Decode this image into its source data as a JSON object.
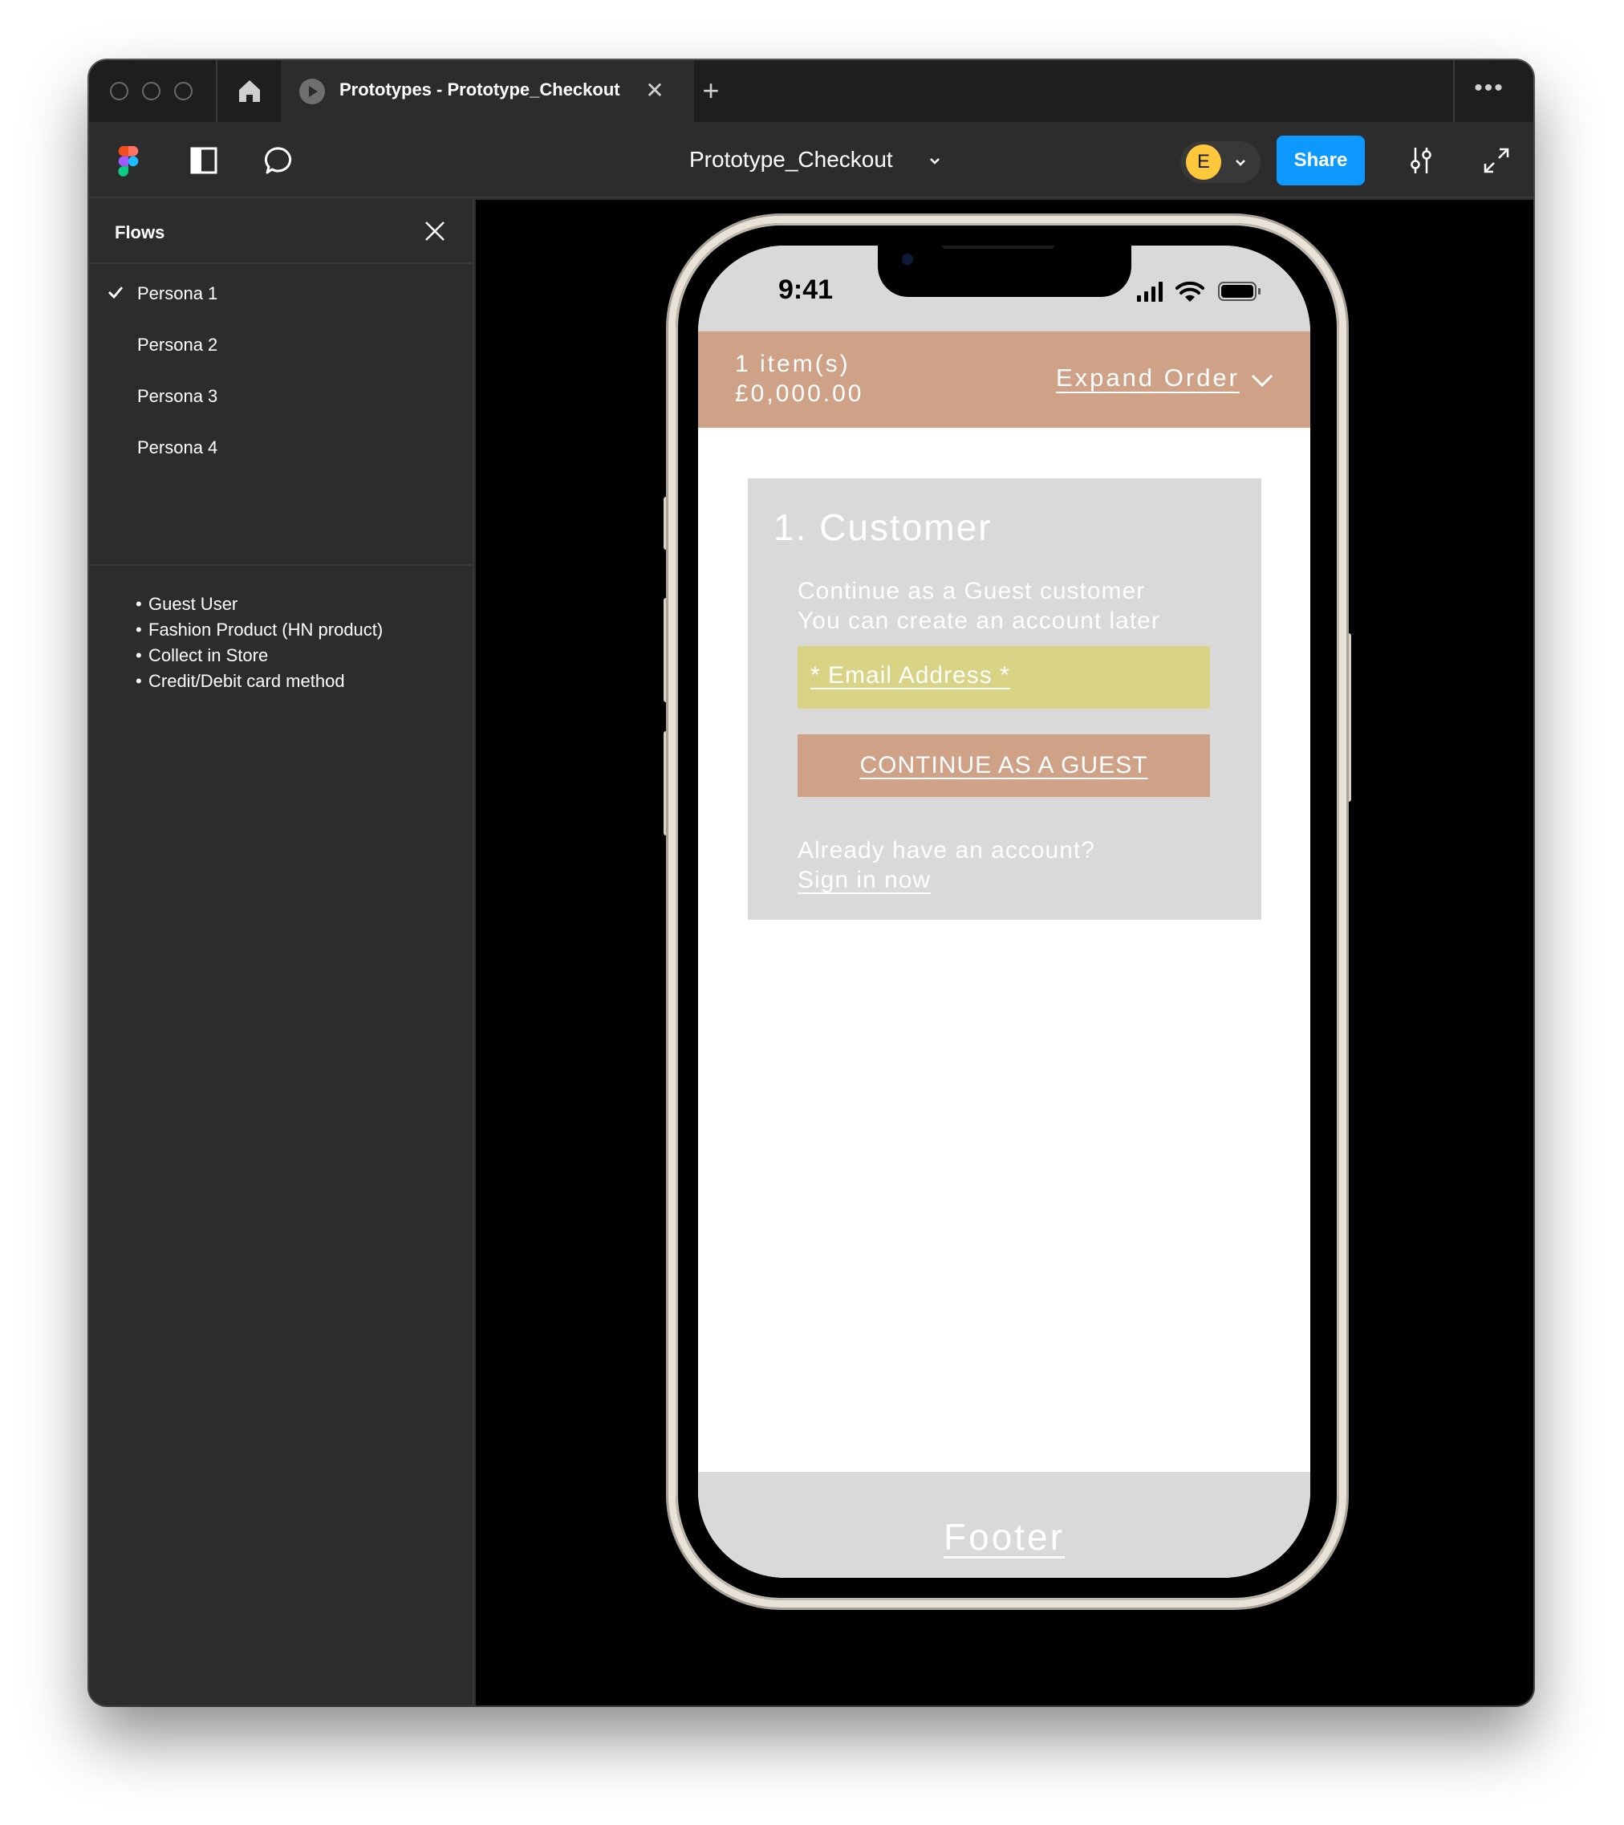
{
  "tabbar": {
    "tab_title": "Prototypes - Prototype_Checkout",
    "close_glyph": "✕",
    "add_glyph": "+",
    "more_glyph": "•••"
  },
  "toolbar": {
    "file_title": "Prototype_Checkout",
    "avatar_initial": "E",
    "avatar_color": "#ffc73b",
    "share_label": "Share",
    "share_color": "#0d99ff"
  },
  "sidebar": {
    "title": "Flows",
    "flows": [
      {
        "label": "Persona 1",
        "selected": true
      },
      {
        "label": "Persona 2",
        "selected": false
      },
      {
        "label": "Persona 3",
        "selected": false
      },
      {
        "label": "Persona 4",
        "selected": false
      }
    ],
    "notes": [
      "Guest User",
      "Fashion Product (HN product)",
      "Collect in Store",
      "Credit/Debit card method"
    ]
  },
  "phone": {
    "time": "9:41",
    "order": {
      "count": "1 item(s)",
      "total": "£0,000.00",
      "expand_label": "Expand Order",
      "color": "#cfa287"
    },
    "customer": {
      "title": "1. Customer",
      "subtitle_line1": "Continue as a Guest customer",
      "subtitle_line2": "You can create an account later",
      "email_placeholder": "* Email Address *",
      "email_color": "#d8d385",
      "guest_button": "CONTINUE AS A GUEST",
      "have_account": "Already have an account?",
      "sign_in": "Sign in now"
    },
    "footer": "Footer"
  }
}
